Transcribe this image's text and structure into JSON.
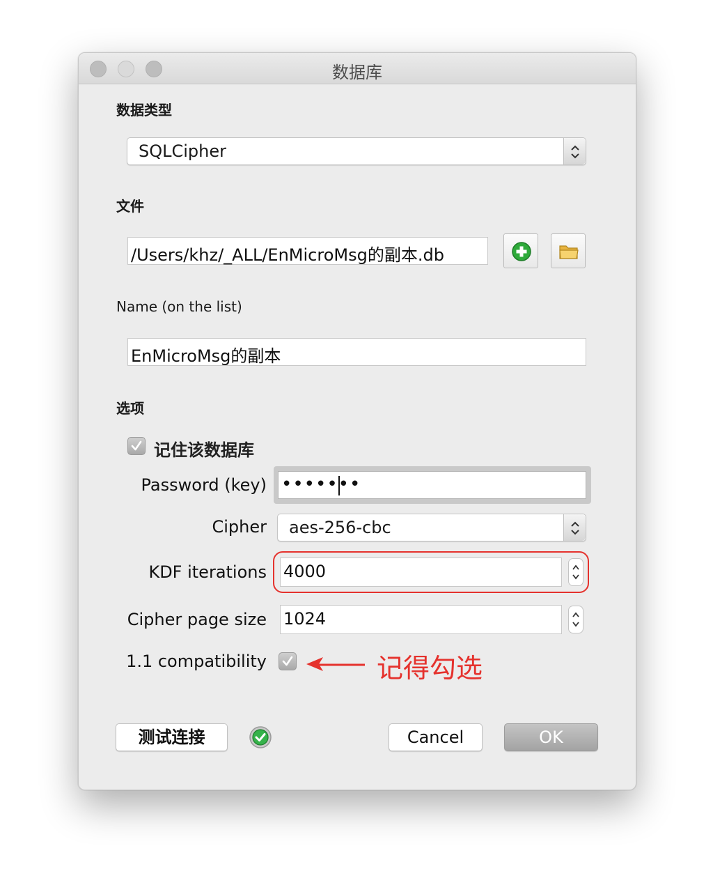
{
  "window": {
    "title": "数据库"
  },
  "db_type": {
    "label": "数据类型",
    "value": "SQLCipher"
  },
  "file": {
    "label": "文件",
    "path": "/Users/khz/_ALL/EnMicroMsg的副本.db",
    "add_icon": "plus-circle-icon",
    "browse_icon": "folder-icon"
  },
  "name": {
    "label": "Name (on the list)",
    "value": "EnMicroMsg的副本"
  },
  "options": {
    "label": "选项",
    "remember_label": "记住该数据库",
    "remember_checked": true,
    "password_label": "Password (key)",
    "password_mask": "•••••••",
    "cipher_label": "Cipher",
    "cipher_value": "aes-256-cbc",
    "kdf_label": "KDF iterations",
    "kdf_value": "4000",
    "page_size_label": "Cipher page size",
    "page_size_value": "1024",
    "compat_label": "1.1 compatibility",
    "compat_checked": true
  },
  "annotation": {
    "text": "记得勾选",
    "color": "#e5322d"
  },
  "footer": {
    "test_label": "测试连接",
    "status_icon": "check-circle-icon",
    "cancel_label": "Cancel",
    "ok_label": "OK"
  }
}
